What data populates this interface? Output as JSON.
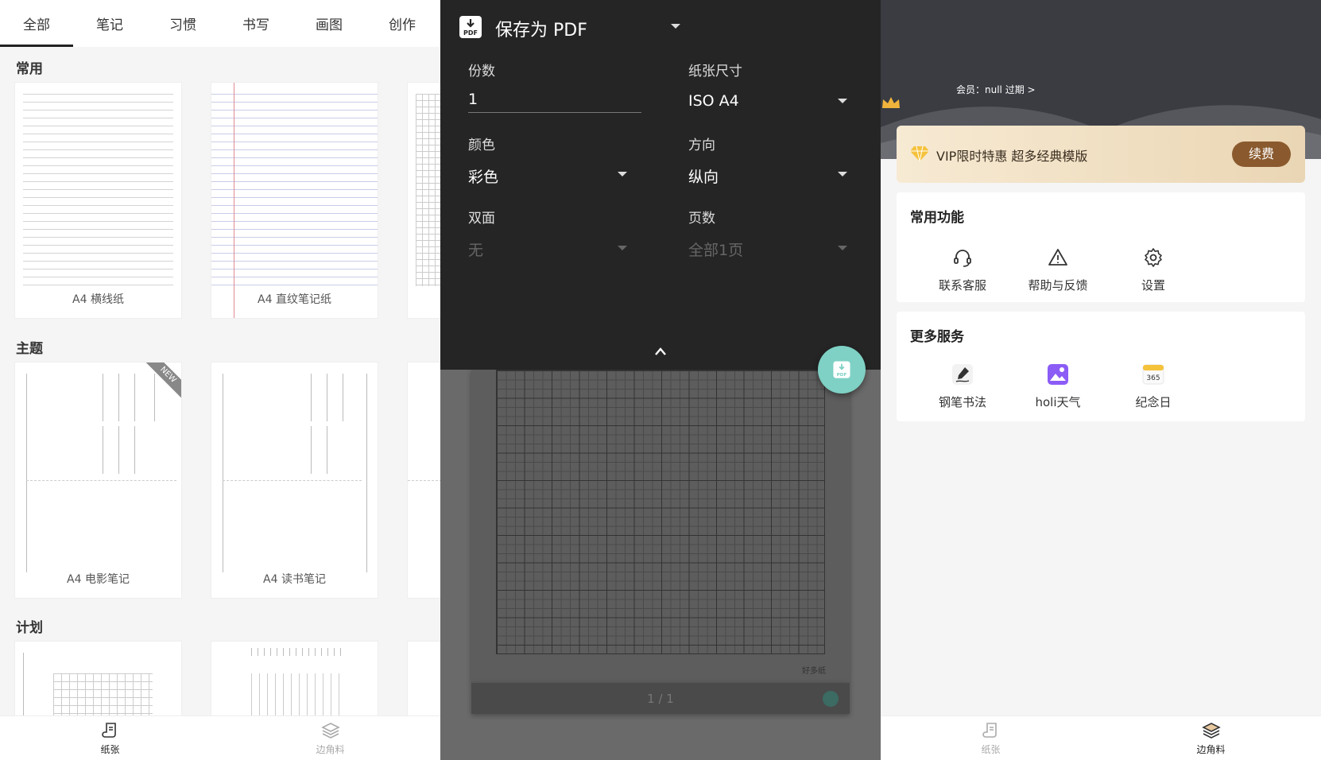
{
  "left": {
    "tabs": [
      "全部",
      "笔记",
      "习惯",
      "书写",
      "画图",
      "创作"
    ],
    "sections": {
      "common": "常用",
      "theme": "主题",
      "plan": "计划"
    },
    "cards": {
      "lined": "A4 横线纸",
      "straight": "A4 直纹笔记纸",
      "movie": "A4 电影笔记",
      "reading": "A4 读书笔记"
    },
    "new_badge": "NEW",
    "nav": [
      "纸张",
      "边角料"
    ]
  },
  "mid": {
    "title": "保存为 PDF",
    "copies_label": "份数",
    "copies_value": "1",
    "paper_label": "纸张尺寸",
    "paper_value": "ISO A4",
    "color_label": "颜色",
    "color_value": "彩色",
    "orientation_label": "方向",
    "orientation_value": "纵向",
    "duplex_label": "双面",
    "duplex_value": "无",
    "pages_label": "页数",
    "pages_value": "全部1页",
    "preview_brand": "好多纸",
    "page_count": "1 / 1",
    "fab_icon": "pdf-download-icon"
  },
  "right": {
    "member": "会员：null 过期 >",
    "vip_text": "VIP限时特惠 超多经典模版",
    "vip_button": "续费",
    "common_title": "常用功能",
    "common": [
      "联系客服",
      "帮助与反馈",
      "设置"
    ],
    "more_title": "更多服务",
    "more": [
      "钢笔书法",
      "holi天气",
      "纪念日"
    ],
    "calendar_number": "365",
    "nav": [
      "纸张",
      "边角料"
    ]
  },
  "colors": {
    "accent_teal": "#7ed1c4",
    "vip_button": "#8a5a2e",
    "dark_panel": "#252525"
  }
}
